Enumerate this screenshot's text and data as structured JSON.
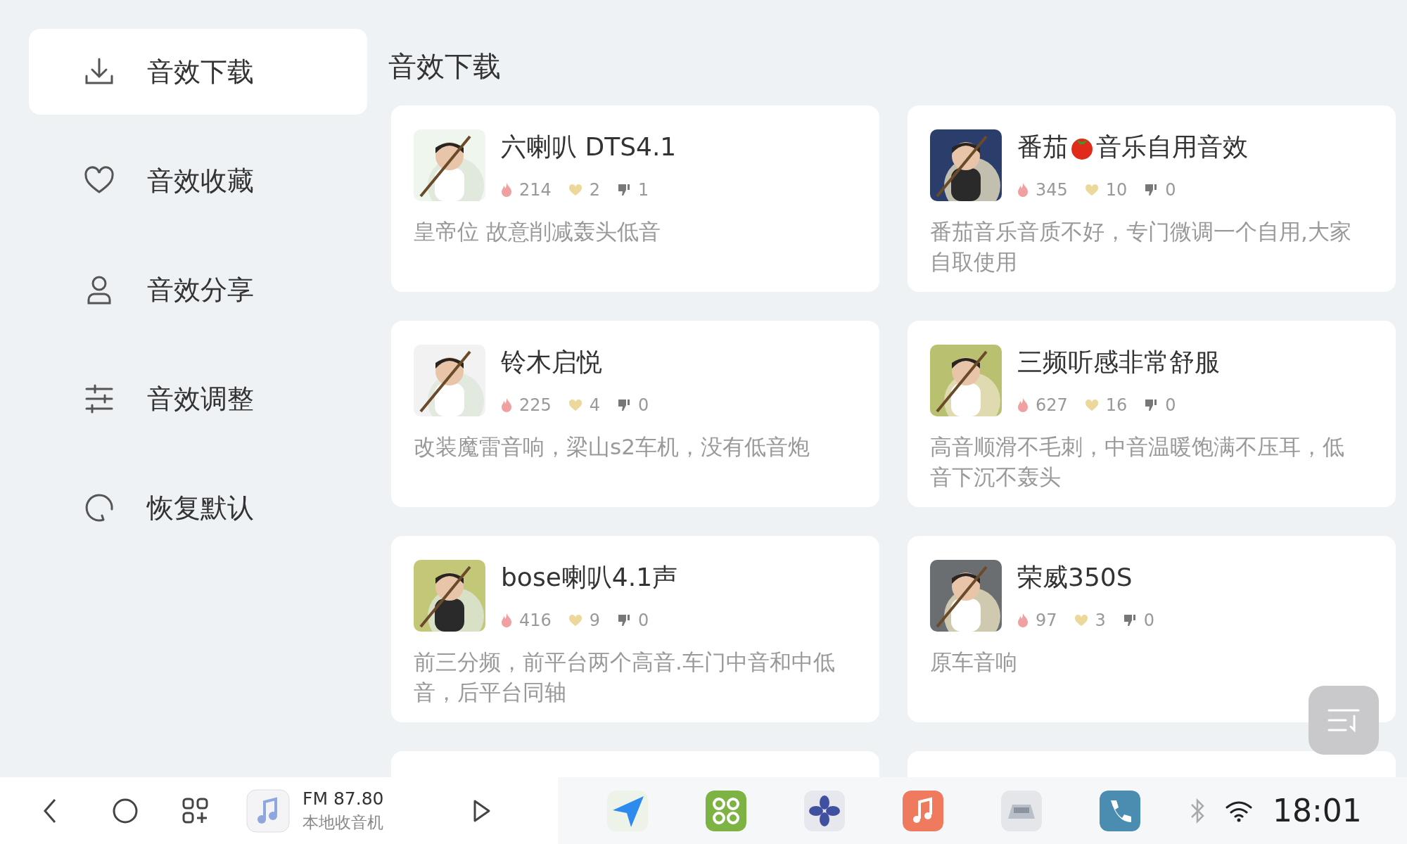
{
  "sidebar": {
    "items": [
      {
        "label": "音效下载",
        "selected": true
      },
      {
        "label": "音效收藏",
        "selected": false
      },
      {
        "label": "音效分享",
        "selected": false
      },
      {
        "label": "音效调整",
        "selected": false
      },
      {
        "label": "恢复默认",
        "selected": false
      }
    ]
  },
  "heading": "音效下载",
  "cards": [
    {
      "title": "六喇叭 DTS4.1",
      "hot": "214",
      "likes": "2",
      "dislikes": "1",
      "description": "皇帝位 故意削减轰头低音",
      "kind": "preset"
    },
    {
      "title": "番茄",
      "title_suffix": "音乐自用音效",
      "hot": "345",
      "likes": "10",
      "dislikes": "0",
      "description": "番茄音乐音质不好，专门微调一个自用,大家自取使用",
      "kind": "preset"
    },
    {
      "title": "铃木启悦",
      "hot": "225",
      "likes": "4",
      "dislikes": "0",
      "description": "改装魔雷音响，梁山s2车机，没有低音炮",
      "kind": "preset"
    },
    {
      "title": "三频听感非常舒服",
      "hot": "627",
      "likes": "16",
      "dislikes": "0",
      "description": "高音顺滑不毛刺，中音温暖饱满不压耳，低音下沉不轰头",
      "kind": "preset"
    },
    {
      "title": "bose喇叭4.1声",
      "hot": "416",
      "likes": "9",
      "dislikes": "0",
      "description": "前三分频，前平台两个高音.车门中音和中低音，后平台同轴",
      "kind": "preset"
    },
    {
      "title": "荣威350S",
      "hot": "97",
      "likes": "3",
      "dislikes": "0",
      "description": "原车音响",
      "kind": "preset"
    },
    {
      "kind": "partial"
    },
    {
      "kind": "partial"
    }
  ],
  "taskbar": {
    "radio_frequency": "FM 87.80",
    "radio_source": "本地收音机",
    "time": "18:01"
  }
}
